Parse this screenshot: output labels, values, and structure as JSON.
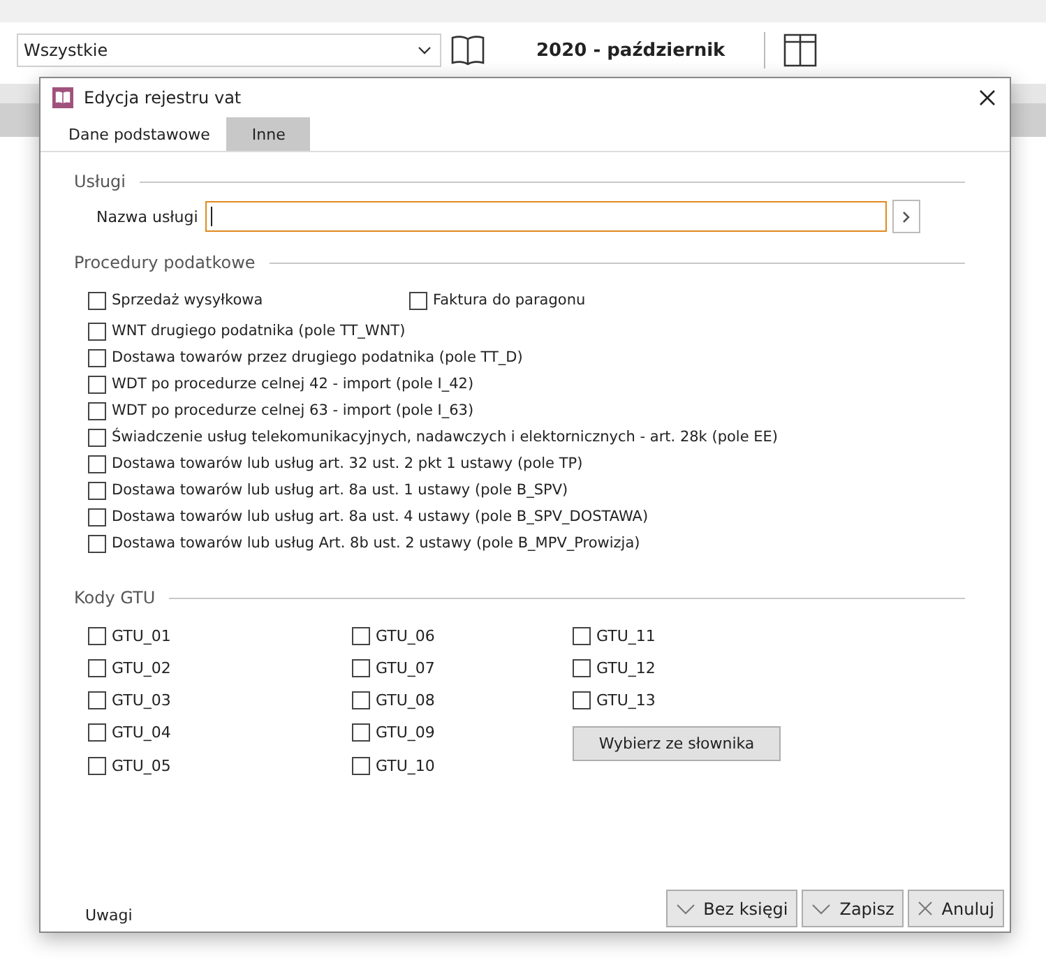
{
  "toolbar": {
    "filter": {
      "value": "Wszystkie"
    },
    "period": "2020 - październik"
  },
  "dialog": {
    "title": "Edycja rejestru vat",
    "tabs": [
      {
        "label": "Dane podstawowe",
        "selected": false
      },
      {
        "label": "Inne",
        "selected": true
      }
    ],
    "uslugi": {
      "heading": "Usługi",
      "label": "Nazwa usługi"
    },
    "procedury": {
      "heading": "Procedury podatkowe",
      "top": [
        {
          "label": "Sprzedaż wysyłkowa",
          "checked": false
        },
        {
          "label": "Faktura do paragonu",
          "checked": false
        }
      ],
      "items": [
        {
          "label": "WNT drugiego podatnika (pole TT_WNT)",
          "checked": false
        },
        {
          "label": "Dostawa towarów przez drugiego podatnika (pole TT_D)",
          "checked": false
        },
        {
          "label": "WDT po procedurze celnej 42 - import (pole I_42)",
          "checked": false
        },
        {
          "label": "WDT po procedurze celnej 63 - import (pole I_63)",
          "checked": false
        },
        {
          "label": "Świadczenie usług telekomunikacyjnych, nadawczych i elektornicznych - art. 28k (pole EE)",
          "checked": false
        },
        {
          "label": "Dostawa towarów lub usług art. 32 ust. 2 pkt 1 ustawy (pole TP)",
          "checked": false
        },
        {
          "label": "Dostawa towarów lub usług art. 8a ust. 1 ustawy (pole B_SPV)",
          "checked": false
        },
        {
          "label": "Dostawa towarów lub usług art. 8a ust. 4 ustawy (pole B_SPV_DOSTAWA)",
          "checked": false
        },
        {
          "label": "Dostawa towarów lub usług Art. 8b ust. 2 ustawy (pole B_MPV_Prowizja)",
          "checked": false
        }
      ]
    },
    "gtu": {
      "heading": "Kody GTU",
      "columns": [
        [
          {
            "label": "GTU_01",
            "checked": false
          },
          {
            "label": "GTU_02",
            "checked": false
          },
          {
            "label": "GTU_03",
            "checked": false
          },
          {
            "label": "GTU_04",
            "checked": false
          },
          {
            "label": "GTU_05",
            "checked": false
          }
        ],
        [
          {
            "label": "GTU_06",
            "checked": false
          },
          {
            "label": "GTU_07",
            "checked": false
          },
          {
            "label": "GTU_08",
            "checked": false
          },
          {
            "label": "GTU_09",
            "checked": false
          },
          {
            "label": "GTU_10",
            "checked": false
          }
        ],
        [
          {
            "label": "GTU_11",
            "checked": false
          },
          {
            "label": "GTU_12",
            "checked": false
          },
          {
            "label": "GTU_13",
            "checked": false
          }
        ]
      ],
      "button": "Wybierz ze słownika"
    },
    "notes_link": "Uwagi",
    "buttons": [
      {
        "label": "Bez księgi",
        "kind": "check"
      },
      {
        "label": "Zapisz",
        "kind": "check"
      },
      {
        "label": "Anuluj",
        "kind": "cancel"
      }
    ]
  }
}
